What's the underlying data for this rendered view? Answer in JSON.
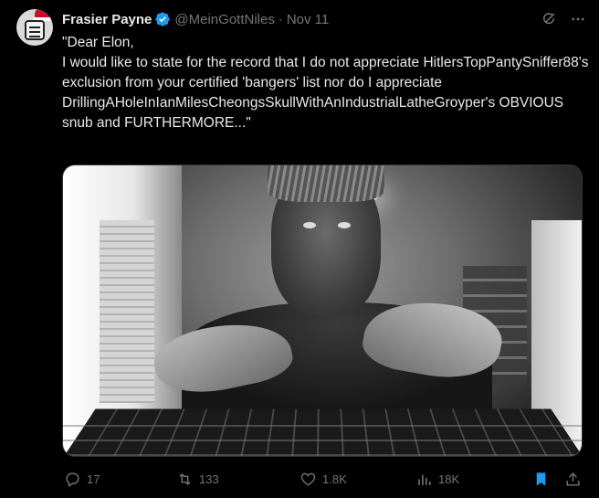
{
  "tweet": {
    "author_name": "Frasier Payne",
    "handle": "@MeinGottNiles",
    "separator": "·",
    "date": "Nov 11",
    "text": "\"Dear Elon,\nI would like to state for the record that I do not appreciate HitlersTopPantySniffer88's exclusion from your certified 'bangers' list nor do I appreciate DrillingAHoleInIanMilesCheongsSkullWithAnIndustrialLatheGroyper's OBVIOUS snub and FURTHERMORE...\""
  },
  "actions": {
    "replies": "17",
    "reposts": "133",
    "likes": "1.8K",
    "views": "18K"
  },
  "colors": {
    "verified": "#1d9bf0",
    "bookmark_active": "#1d9bf0",
    "muted": "#71767b"
  },
  "icons": [
    "verified-badge-icon",
    "grok-icon",
    "more-icon",
    "reply-icon",
    "repost-icon",
    "like-icon",
    "views-icon",
    "bookmark-icon",
    "share-icon"
  ]
}
